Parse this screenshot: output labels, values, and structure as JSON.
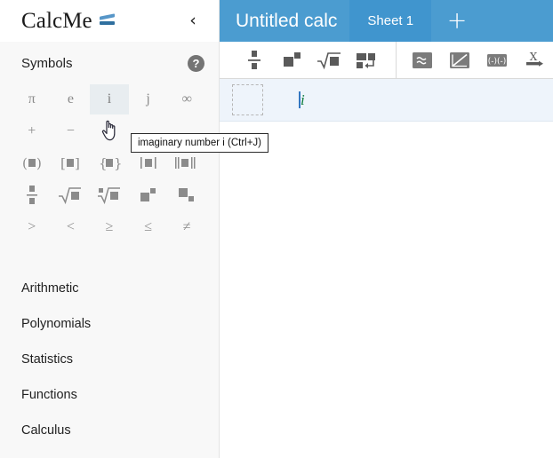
{
  "sidebar": {
    "brand": {
      "name": "CalcMe",
      "logo_icon": "calcme-equals-logo"
    },
    "collapse_icon": "chevron-left-icon",
    "section": {
      "title": "Symbols",
      "help_icon": "question-mark-icon",
      "help_glyph": "?"
    },
    "symbols": [
      {
        "glyph": "π",
        "name": "symbol-pi",
        "highlighted": false
      },
      {
        "glyph": "e",
        "name": "symbol-e",
        "highlighted": false
      },
      {
        "glyph": "i",
        "name": "symbol-imaginary-i",
        "highlighted": true
      },
      {
        "glyph": "j",
        "name": "symbol-imaginary-j",
        "highlighted": false
      },
      {
        "glyph": "∞",
        "name": "symbol-infinity",
        "highlighted": false
      },
      {
        "glyph": "+",
        "name": "symbol-plus",
        "highlighted": false
      },
      {
        "glyph": "−",
        "name": "symbol-minus",
        "highlighted": false
      },
      {
        "glyph": "×",
        "name": "symbol-times",
        "highlighted": false
      },
      {
        "glyph": "",
        "name": "symbol-empty-1",
        "highlighted": false
      },
      {
        "glyph": "",
        "name": "symbol-empty-2",
        "highlighted": false
      },
      {
        "glyph": "(■)",
        "name": "symbol-parentheses",
        "highlighted": false
      },
      {
        "glyph": "[■]",
        "name": "symbol-square-brackets",
        "highlighted": false
      },
      {
        "glyph": "{■}",
        "name": "symbol-curly-braces",
        "highlighted": false
      },
      {
        "glyph": "|■|",
        "name": "symbol-absolute-value",
        "highlighted": false
      },
      {
        "glyph": "‖■‖",
        "name": "symbol-norm",
        "highlighted": false
      },
      {
        "glyph": "",
        "name": "symbol-fraction",
        "highlighted": false
      },
      {
        "glyph": "",
        "name": "symbol-square-root",
        "highlighted": false
      },
      {
        "glyph": "",
        "name": "symbol-nth-root",
        "highlighted": false
      },
      {
        "glyph": "",
        "name": "symbol-superscript",
        "highlighted": false
      },
      {
        "glyph": "",
        "name": "symbol-subscript",
        "highlighted": false
      },
      {
        "glyph": ">",
        "name": "symbol-greater-than",
        "highlighted": false
      },
      {
        "glyph": "<",
        "name": "symbol-less-than",
        "highlighted": false
      },
      {
        "glyph": "≥",
        "name": "symbol-greater-equal",
        "highlighted": false
      },
      {
        "glyph": "≤",
        "name": "symbol-less-equal",
        "highlighted": false
      },
      {
        "glyph": "≠",
        "name": "symbol-not-equal",
        "highlighted": false
      }
    ],
    "categories": [
      {
        "label": "Arithmetic"
      },
      {
        "label": "Polynomials"
      },
      {
        "label": "Statistics"
      },
      {
        "label": "Functions"
      },
      {
        "label": "Calculus"
      }
    ]
  },
  "tooltip": {
    "text": "imaginary number i (Ctrl+J)"
  },
  "cursor": {
    "type": "pointing-hand-cursor"
  },
  "main": {
    "document_title": "Untitled calc",
    "sheet_tab": "Sheet 1",
    "add_tab_label": "+",
    "toolbar": [
      {
        "name": "fraction-button",
        "icon": "fraction-icon"
      },
      {
        "name": "superscript-button",
        "icon": "superscript-icon"
      },
      {
        "name": "square-root-button",
        "icon": "square-root-icon"
      },
      {
        "name": "new-line-button",
        "icon": "new-line-icon"
      },
      {
        "name": "approximate-button",
        "icon": "approximately-equal-icon"
      },
      {
        "name": "plot-button",
        "icon": "plot-diagonal-icon"
      },
      {
        "name": "interval-button",
        "icon": "interval-icon"
      },
      {
        "name": "substitute-button",
        "icon": "x-arrow-icon"
      }
    ],
    "cell": {
      "value": "i",
      "handle_name": "cell-drag-handle"
    }
  },
  "colors": {
    "tabbar_blue": "#4b9cd0",
    "active_tab_blue": "#4095ce",
    "cell_row_blue": "#eef4fb",
    "sidebar_bg": "#f8f8f8",
    "symbol_grey": "#8b8b8b",
    "math_green": "#0e7c3f"
  }
}
